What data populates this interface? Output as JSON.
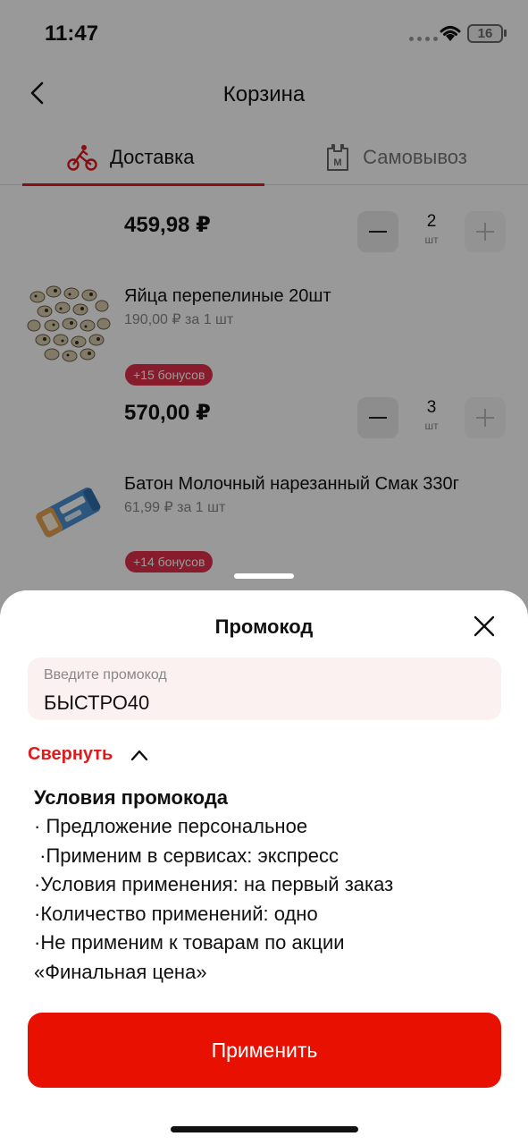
{
  "status_bar": {
    "time": "11:47",
    "battery": "16"
  },
  "header": {
    "title": "Корзина"
  },
  "tabs": [
    {
      "label": "Доставка",
      "active": true,
      "icon": "courier-bike-icon"
    },
    {
      "label": "Самовывоз",
      "active": false,
      "icon": "shopping-bag-icon"
    }
  ],
  "cart": {
    "items": [
      {
        "name": "",
        "price": "459,98 ₽",
        "quantity": "2",
        "unit": "шт"
      },
      {
        "name": "Яйца перепелиные 20шт",
        "unit_price": "190,00 ₽ за 1 шт",
        "bonus": "+15 бонусов",
        "price": "570,00 ₽",
        "quantity": "3",
        "unit": "шт"
      },
      {
        "name": "Батон Молочный нарезанный Смак 330г",
        "unit_price": "61,99 ₽ за 1 шт",
        "bonus": "+14 бонусов"
      }
    ]
  },
  "promo_sheet": {
    "title": "Промокод",
    "input_placeholder": "Введите промокод",
    "input_value": "БЫСТРО40",
    "collapse_label": "Свернуть",
    "conditions_title": "Условия промокода",
    "conditions": [
      "· Предложение персональное",
      " ·Применим в сервисах: экспресс",
      "·Условия применения: на первый заказ",
      "·Количество применений: одно",
      "·Не применим к товарам по акции",
      "«Финальная цена»"
    ],
    "apply_label": "Применить"
  },
  "colors": {
    "accent": "#e01a1a",
    "button": "#e81000",
    "bonus": "#e0304a"
  }
}
